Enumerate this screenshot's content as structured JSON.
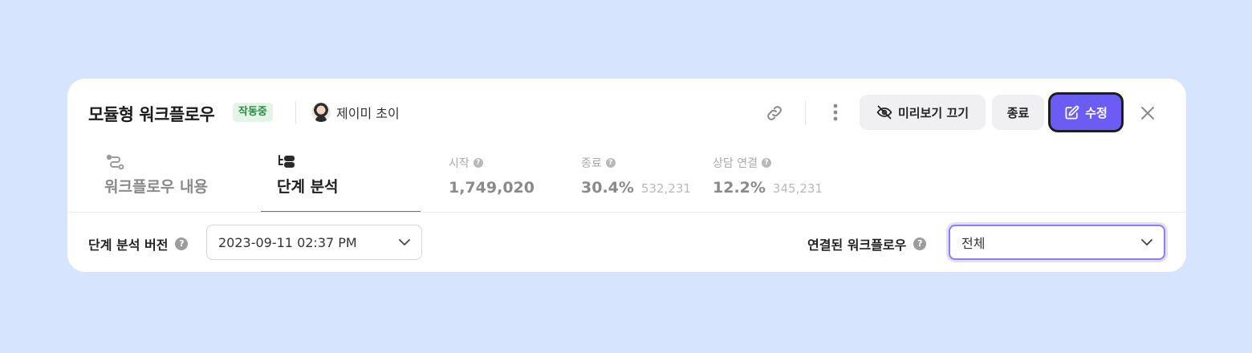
{
  "header": {
    "title": "모듈형 워크플로우",
    "status": "작동중",
    "owner": "제이미 초이",
    "buttons": {
      "preview_off": "미리보기 끄기",
      "end": "종료",
      "edit": "수정"
    }
  },
  "tabs": [
    {
      "label": "워크플로우 내용",
      "icon": "workflow-route-icon",
      "active": false
    },
    {
      "label": "단계 분석",
      "icon": "step-tree-icon",
      "active": true
    }
  ],
  "stats": [
    {
      "label": "시작",
      "value": "1,749,020",
      "sub": ""
    },
    {
      "label": "종료",
      "value": "30.4%",
      "sub": "532,231"
    },
    {
      "label": "상담 연결",
      "value": "12.2%",
      "sub": "345,231"
    }
  ],
  "filters": {
    "version_label": "단계 분석 버전",
    "version_value": "2023-09-11 02:37 PM",
    "linked_label": "연결된 워크플로우",
    "linked_value": "전체"
  },
  "colors": {
    "background": "#d6e4fd",
    "accent": "#6b5cf3",
    "status_bg": "#e3f5e7",
    "status_text": "#2f8a47"
  }
}
